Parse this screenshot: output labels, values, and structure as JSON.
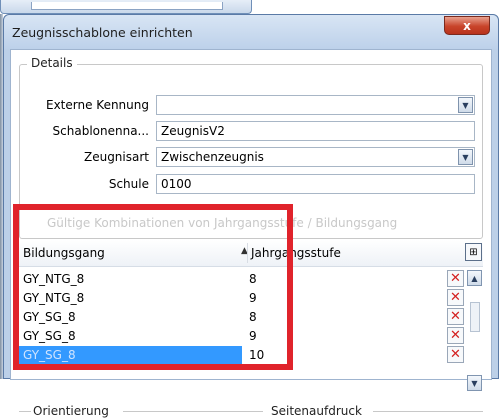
{
  "dialog": {
    "title": "Zeugnisschablone einrichten",
    "close_label": "x"
  },
  "details": {
    "legend": "Details",
    "fields": [
      {
        "label": "Externe Kennung",
        "value": "",
        "type": "dropdown"
      },
      {
        "label": "Schablonenna...",
        "value": "ZeugnisV2",
        "type": "text"
      },
      {
        "label": "Zeugnisart",
        "value": "Zwischenzeugnis",
        "type": "dropdown"
      },
      {
        "label": "Schule",
        "value": "0100",
        "type": "text"
      }
    ]
  },
  "grid_section": {
    "faded_legend": "Gültige Kombinationen von Jahrgangsstufe / Bildungsgang"
  },
  "grid": {
    "columns": [
      "Bildungsgang",
      "Jahrgangsstufe"
    ],
    "sort_indicator": "▲",
    "filter_icon": "filter-icon",
    "rows": [
      {
        "bildungsgang": "GY_NTG_8",
        "jahrgangsstufe": "8",
        "selected": false
      },
      {
        "bildungsgang": "GY_NTG_8",
        "jahrgangsstufe": "9",
        "selected": false
      },
      {
        "bildungsgang": "GY_SG_8",
        "jahrgangsstufe": "8",
        "selected": false
      },
      {
        "bildungsgang": "GY_SG_8",
        "jahrgangsstufe": "9",
        "selected": false
      },
      {
        "bildungsgang": "GY_SG_8",
        "jahrgangsstufe": "10",
        "selected": true
      }
    ],
    "delete_icon": "delete-x-icon"
  },
  "bottom": {
    "left_legend": "Orientierung",
    "right_legend": "Seitenaufdruck"
  },
  "colors": {
    "highlight": "#e0232b",
    "selection": "#3399ff",
    "delete": "#d42020"
  }
}
